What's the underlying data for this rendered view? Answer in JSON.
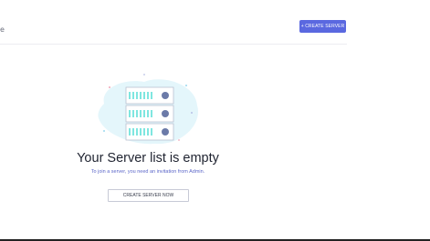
{
  "header": {
    "edge_text": "e",
    "create_button": "+ CREATE SERVER"
  },
  "empty_state": {
    "title": "Your Server list is empty",
    "subtitle": "To join a server, you need an invitation from Admin.",
    "button": "CREATE SERVER NOW",
    "illustration_icon": "server-rack-icon"
  },
  "colors": {
    "accent": "#5a68e0",
    "blob": "#e4f6fb",
    "bars": "#7fe6e0",
    "led": "#6b7aa8"
  }
}
